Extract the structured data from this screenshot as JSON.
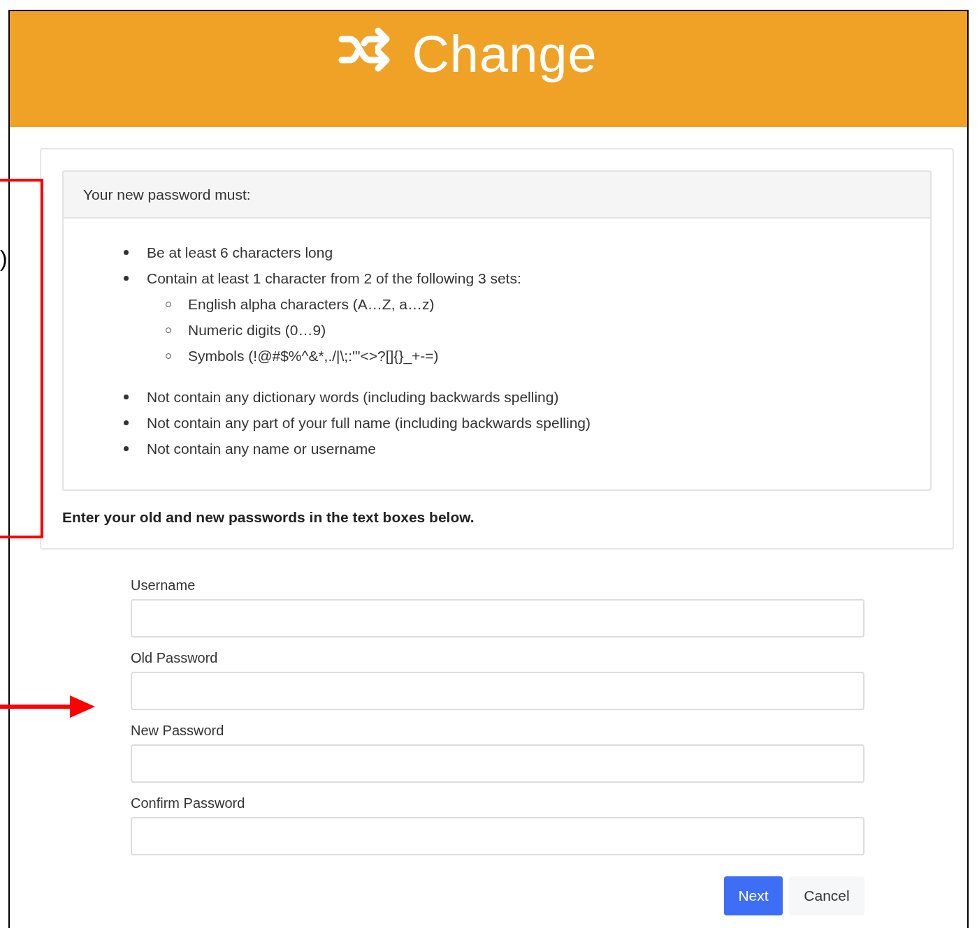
{
  "header": {
    "title": "Change"
  },
  "annotation": {
    "text": ")"
  },
  "requirements": {
    "heading": "Your new password must:",
    "items": [
      {
        "text": "Be at least 6 characters long"
      },
      {
        "text": "Contain at least 1 character from 2 of the following 3 sets:",
        "children": [
          {
            "text": "English alpha characters (A…Z, a…z)"
          },
          {
            "text": "Numeric digits (0…9)"
          },
          {
            "text": "Symbols (!@#$%^&*,./|\\;:'\"<>?[]{}_+-=)"
          }
        ]
      },
      {
        "text": "Not contain any dictionary words (including backwards spelling)"
      },
      {
        "text": "Not contain any part of your full name (including backwards spelling)"
      },
      {
        "text": "Not contain any name or username"
      }
    ]
  },
  "instruction": "Enter your old and new passwords in the text boxes below.",
  "fields": [
    {
      "label": "Username"
    },
    {
      "label": "Old Password"
    },
    {
      "label": "New Password"
    },
    {
      "label": "Confirm Password"
    }
  ],
  "buttons": [
    {
      "label": "Next",
      "kind": "primary"
    },
    {
      "label": "Cancel",
      "kind": "secondary"
    }
  ]
}
